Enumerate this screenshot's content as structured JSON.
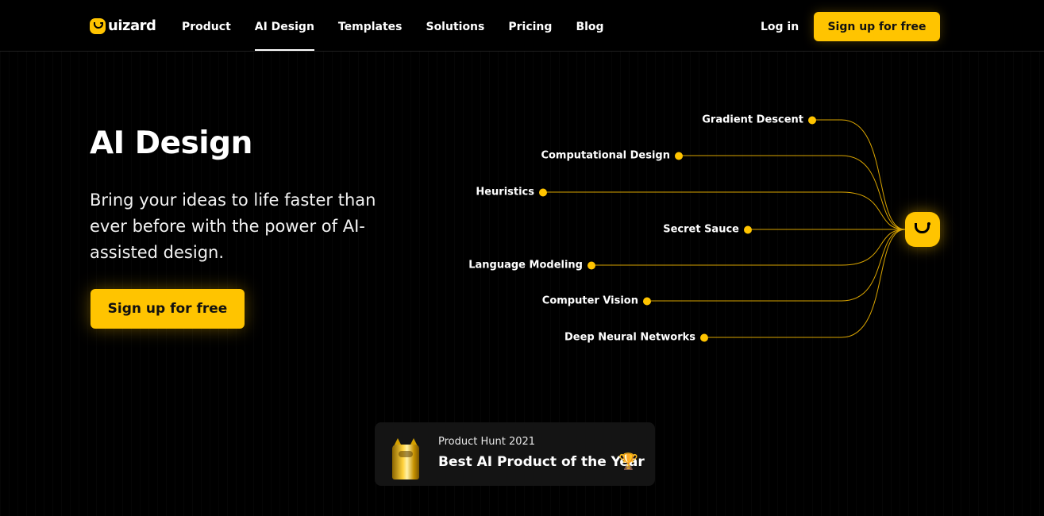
{
  "brand": {
    "name": "uizard",
    "color": "#ffc400"
  },
  "nav": {
    "links": [
      "Product",
      "AI Design",
      "Templates",
      "Solutions",
      "Pricing",
      "Blog"
    ],
    "active": "AI Design",
    "login_label": "Log in",
    "cta_label": "Sign up for free"
  },
  "hero": {
    "title": "AI Design",
    "subtitle": "Bring your ideas to life faster than ever before with the power of AI-assisted design.",
    "cta_label": "Sign up for free"
  },
  "diagram": {
    "nodes": [
      "Gradient Descent",
      "Computational Design",
      "Heuristics",
      "Secret Sauce",
      "Language Modeling",
      "Computer Vision",
      "Deep Neural Networks"
    ],
    "hub_icon": "uizard-logo-icon"
  },
  "award": {
    "small": "Product Hunt 2021",
    "big": "Best AI Product of the Year",
    "trophy_icon": "trophy-icon",
    "badge_icon": "golden-kitty-icon"
  }
}
